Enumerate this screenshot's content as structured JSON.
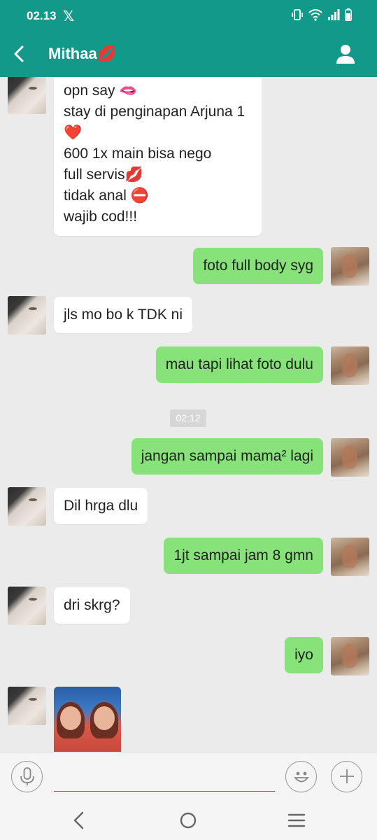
{
  "status_bar": {
    "time": "02.13",
    "x_glyph": "𝕏"
  },
  "header": {
    "contact_name": "Mithaa💋"
  },
  "messages": [
    {
      "dir": "in",
      "lines": [
        "opn say 🫦",
        "stay di penginapan Arjuna 1",
        "❤️",
        "600 1x main bisa nego",
        "full servis💋",
        "tidak anal ⛔",
        "wajib cod!!!"
      ]
    },
    {
      "dir": "out",
      "text": "foto full body syg"
    },
    {
      "dir": "in",
      "text": "jls mo bo k TDK ni"
    },
    {
      "dir": "out",
      "text": "mau tapi lihat foto dulu"
    },
    {
      "dir": "out",
      "text": "jangan sampai mama² lagi"
    },
    {
      "dir": "in",
      "text": "Dil hrga dlu"
    },
    {
      "dir": "out",
      "text": "1jt sampai jam 8 gmn"
    },
    {
      "dir": "in",
      "text": "dri skrg?"
    },
    {
      "dir": "out",
      "text": "iyo"
    },
    {
      "dir": "in",
      "type": "image"
    }
  ],
  "time_divider": "02:12",
  "input": {
    "value": "",
    "placeholder": ""
  },
  "icons": {
    "back": "back-arrow-icon",
    "profile": "person-icon",
    "mic": "microphone-icon",
    "emoji": "smiley-icon",
    "attach": "plus-icon",
    "nav_back": "nav-back-icon",
    "nav_home": "nav-home-icon",
    "nav_menu": "nav-recents-icon"
  },
  "colors": {
    "header": "#13998a",
    "outgoing_bubble": "#88e27a",
    "incoming_bubble": "#ffffff",
    "background": "#ebebeb"
  }
}
